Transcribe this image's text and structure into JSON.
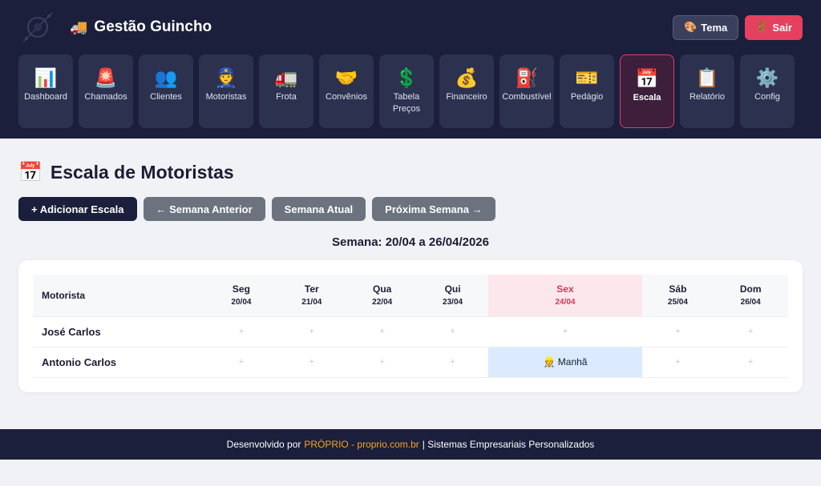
{
  "app": {
    "title": "Gestão Guincho",
    "title_emoji": "🚚"
  },
  "top_actions": {
    "theme_label": "Tema",
    "theme_emoji": "🎨",
    "logout_label": "Sair",
    "logout_emoji": "🚪"
  },
  "nav": [
    {
      "name": "dashboard",
      "emoji": "📊",
      "label": "Dashboard"
    },
    {
      "name": "chamados",
      "emoji": "🚨",
      "label": "Chamados"
    },
    {
      "name": "clientes",
      "emoji": "👥",
      "label": "Clientes"
    },
    {
      "name": "motoristas",
      "emoji": "👮",
      "label": "Motoristas"
    },
    {
      "name": "frota",
      "emoji": "🚛",
      "label": "Frota"
    },
    {
      "name": "convenios",
      "emoji": "🤝",
      "label": "Convênios"
    },
    {
      "name": "tabela-precos",
      "emoji": "💲",
      "label": "Tabela Preços"
    },
    {
      "name": "financeiro",
      "emoji": "💰",
      "label": "Financeiro"
    },
    {
      "name": "combustivel",
      "emoji": "⛽",
      "label": "Combustível"
    },
    {
      "name": "pedagio",
      "emoji": "🎫",
      "label": "Pedágio"
    },
    {
      "name": "escala",
      "emoji": "📅",
      "label": "Escala",
      "active": true
    },
    {
      "name": "relatorio",
      "emoji": "📋",
      "label": "Relatório"
    },
    {
      "name": "config",
      "emoji": "⚙️",
      "label": "Config"
    }
  ],
  "page": {
    "title": "Escala de Motoristas",
    "title_emoji": "📅"
  },
  "buttons": {
    "add": "+ Adicionar Escala",
    "prev": "← Semana Anterior",
    "current": "Semana Atual",
    "next": "Próxima Semana →"
  },
  "week_label": "Semana: 20/04 a 26/04/2026",
  "table": {
    "driver_header": "Motorista",
    "days": [
      {
        "name": "Seg",
        "date": "20/04"
      },
      {
        "name": "Ter",
        "date": "21/04"
      },
      {
        "name": "Qua",
        "date": "22/04"
      },
      {
        "name": "Qui",
        "date": "23/04"
      },
      {
        "name": "Sex",
        "date": "24/04",
        "today": true
      },
      {
        "name": "Sáb",
        "date": "25/04"
      },
      {
        "name": "Dom",
        "date": "26/04"
      }
    ],
    "empty_marker": "+",
    "rows": [
      {
        "driver": "José Carlos",
        "cells": [
          "+",
          "+",
          "+",
          "+",
          "+",
          "+",
          "+"
        ]
      },
      {
        "driver": "Antonio Carlos",
        "cells": [
          "+",
          "+",
          "+",
          "+",
          "👷 Manhã",
          "+",
          "+"
        ]
      }
    ]
  },
  "footer": {
    "prefix": "Desenvolvido por",
    "brand": "PRÓPRIO - proprio.com.br",
    "suffix": "| Sistemas Empresariais Personalizados"
  },
  "colors": {
    "header_bg": "#1b1f3b",
    "accent": "#e5405e",
    "today_bg": "#fce8ec",
    "shift_bg": "#dbeafe",
    "brand_link": "#f5a623"
  }
}
